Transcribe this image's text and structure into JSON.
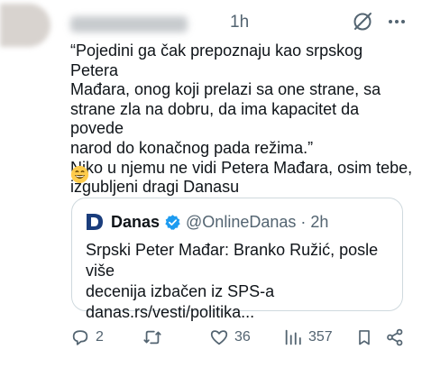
{
  "tweet": {
    "time": "1h",
    "text": "“Pojedini ga čak prepoznaju kao srpskog Petera\nMađara, onog koji prelazi sa one strane, sa\nstrane zla na dobru, da ima kapacitet da povede\nnarod do konačnog pada režima.”\nNiko u njemu ne vidi Petera Mađara, osim tebe,\nizgubljeni dragi Danasu",
    "emoji": "grinning-face-emoji"
  },
  "quote": {
    "name": "Danas",
    "handle": "@OnlineDanas",
    "time": "2h",
    "separator": "·",
    "text_line1": "Srpski Peter Mađar: Branko Ružić, posle više",
    "text_line2": "decenija izbačen iz SPS-a",
    "link": "danas.rs/vesti/politika..."
  },
  "actions": {
    "replies": "2",
    "retweets": "",
    "likes": "36",
    "views": "357"
  },
  "colors": {
    "text": "#0f1419",
    "muted": "#536471",
    "border": "#cfd9de",
    "verified": "#1d9bf0",
    "logo": "#1a3d7c"
  }
}
